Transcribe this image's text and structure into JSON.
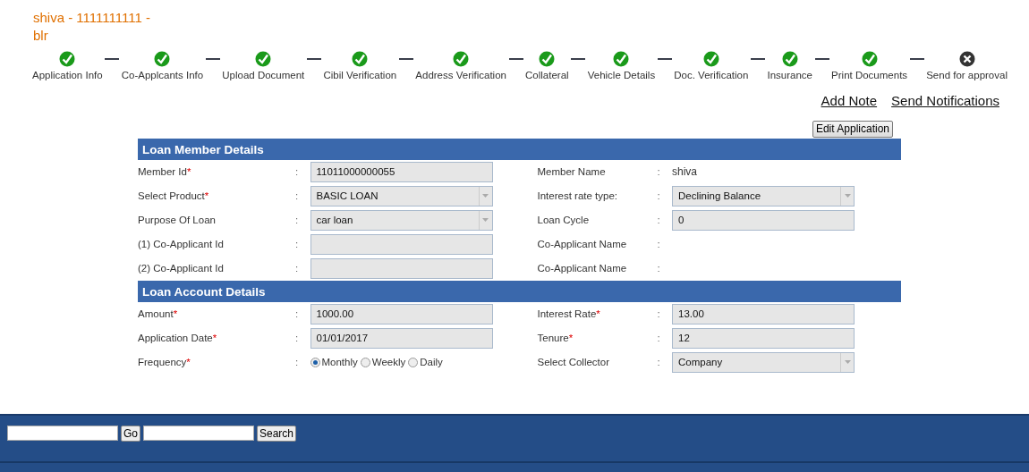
{
  "header": {
    "title": "shiva - 1111111111 - blr"
  },
  "steps": [
    {
      "label": "Application Info",
      "done": true
    },
    {
      "label": "Co-Applcants Info",
      "done": true
    },
    {
      "label": "Upload Document",
      "done": true
    },
    {
      "label": "Cibil Verification",
      "done": true
    },
    {
      "label": "Address Verification",
      "done": true
    },
    {
      "label": "Collateral",
      "done": true
    },
    {
      "label": "Vehicle Details",
      "done": true
    },
    {
      "label": "Doc. Verification",
      "done": true
    },
    {
      "label": "Insurance",
      "done": true
    },
    {
      "label": "Print Documents",
      "done": true
    },
    {
      "label": "Send for approval",
      "done": false
    }
  ],
  "actions": [
    "Add Note",
    "Send Notifications"
  ],
  "edit_button": "Edit Application",
  "sections": [
    {
      "title": "Loan Member Details",
      "rows": [
        {
          "left": {
            "label": "Member Id",
            "required_mark": "*",
            "colon": ":",
            "kind": "text",
            "value": "11011000000055"
          },
          "right": {
            "label": "Member Name",
            "colon": ":",
            "kind": "static",
            "value": "shiva"
          }
        },
        {
          "left": {
            "label": "Select Product",
            "required_mark": "*",
            "colon": ":",
            "kind": "select",
            "value": "BASIC LOAN"
          },
          "right": {
            "label": "Interest rate type:",
            "colon": ":",
            "kind": "select",
            "value": "Declining Balance"
          }
        },
        {
          "left": {
            "label": "Purpose Of Loan",
            "colon": ":",
            "kind": "select",
            "value": "car loan"
          },
          "right": {
            "label": "Loan Cycle",
            "colon": ":",
            "kind": "text",
            "value": "0"
          }
        },
        {
          "left": {
            "label": "(1) Co-Applicant Id",
            "colon": ":",
            "kind": "text"
          },
          "right": {
            "label": "Co-Applicant Name",
            "colon": ":",
            "kind": "empty"
          }
        },
        {
          "left": {
            "label": "(2) Co-Applicant Id",
            "colon": ":",
            "kind": "text"
          },
          "right": {
            "label": "Co-Applicant Name",
            "colon": ":",
            "kind": "empty"
          }
        }
      ]
    },
    {
      "title": "Loan Account Details",
      "rows": [
        {
          "left": {
            "label": "Amount",
            "required_mark": "*",
            "colon": ":",
            "kind": "text",
            "value": "1000.00"
          },
          "right": {
            "label": "Interest Rate",
            "required_mark": "*",
            "colon": ":",
            "kind": "text",
            "value": "13.00"
          }
        },
        {
          "left": {
            "label": "Application Date",
            "required_mark": "*",
            "colon": ":",
            "kind": "text",
            "value": "01/01/2017"
          },
          "right": {
            "label": "Tenure",
            "required_mark": "*",
            "colon": ":",
            "kind": "text",
            "value": "12"
          }
        },
        {
          "left": {
            "label": "Frequency",
            "required_mark": "*",
            "colon": ":",
            "kind": "radio",
            "options": [
              {
                "label": "Monthly",
                "selected": true
              },
              {
                "label": "Weekly",
                "selected": false
              },
              {
                "label": "Daily",
                "selected": false
              }
            ]
          },
          "right": {
            "label": "Select Collector",
            "colon": ":",
            "kind": "select",
            "value": "Company"
          }
        }
      ]
    }
  ],
  "footer": {
    "buttons": [
      "Go",
      "Search"
    ]
  }
}
